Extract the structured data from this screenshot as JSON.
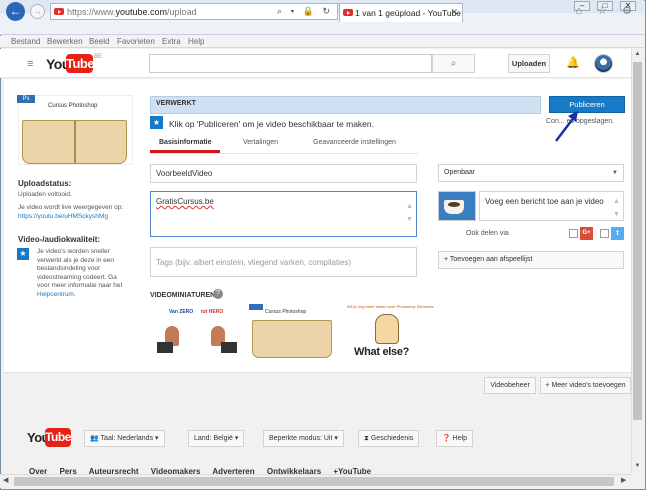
{
  "browser": {
    "url_prefix": "https://www.",
    "url_host": "youtube.com",
    "url_path": "/upload",
    "address_icons": "⌕ ▾ 🔒 ↻",
    "tab_title": "1 van 1 geüpload - YouTube",
    "tab_close": "✕",
    "nav_icons": "⌂ ☆ ⚙",
    "window_controls": [
      "–",
      "□",
      "✕"
    ],
    "menu": [
      "Bestand",
      "Bewerken",
      "Beeld",
      "Favorieten",
      "Extra",
      "Help"
    ]
  },
  "header": {
    "logo_you": "You",
    "logo_tube": "Tube",
    "logo_region": "BE",
    "upload_label": "Uploaden",
    "search_icon": "⌕",
    "bell_icon": "bell-icon"
  },
  "sidebar": {
    "thumb_title": "Cursus Photoshop",
    "upload_status_title": "Uploadstatus:",
    "upload_done": "Uploaden voltooid.",
    "live_text": "Je video wordt live weergegeven op:",
    "video_link": "https://youtu.be/uHMSckyshMg",
    "quality_title": "Video-/audiokwaliteit:",
    "quality_text": "Je video's worden sneller verwerkt als je deze in een bestandsindeling voor videostreaming codeert. Ga voor meer informatie naar het",
    "help_link": "Helpcentrum."
  },
  "main": {
    "status": "VERWERKT",
    "publish_label": "Publiceren",
    "hint": "Klik op 'Publiceren' om je video beschikbaar te maken.",
    "saved": "Con... es opgeslagen.",
    "tabs": [
      "Basisinformatie",
      "Vertalingen",
      "Geavanceerde instellingen"
    ],
    "title_value": "VoorbeeldVideo",
    "description_value": "GratisCursus.be",
    "tags_placeholder": "Tags (bijv. albert einstein, vliegend varken, compilaties)",
    "privacy_value": "Openbaar",
    "message_placeholder": "Voeg een bericht toe aan je video",
    "share_label": "Ook delen via",
    "gplus_label": "G+",
    "twitter_label": "t",
    "playlist_label": "+ Toevoegen aan afspeellijst",
    "thumbs_label": "VIDEOMINIATUREN",
    "thumb1_a": "Van ZERO",
    "thumb1_b": "tot HERO",
    "thumb2_title": "Cursus Photoshop",
    "thumb3_top": "Wil je nog meer weten over Photoshop Elements",
    "thumb3_text": "What else?"
  },
  "actions": {
    "video_manager": "Videobeheer",
    "add_more": "+ Meer video's toevoegen"
  },
  "footer": {
    "logo_you": "You",
    "logo_tube": "Tube",
    "language": "Taal: Nederlands",
    "country": "Land: België",
    "restricted": "Beperkte modus: Uit",
    "history": "Geschiedenis",
    "help": "Help",
    "links": [
      "Over",
      "Pers",
      "Auteursrecht",
      "Videomakers",
      "Adverteren",
      "Ontwikkelaars",
      "+YouTube"
    ]
  }
}
